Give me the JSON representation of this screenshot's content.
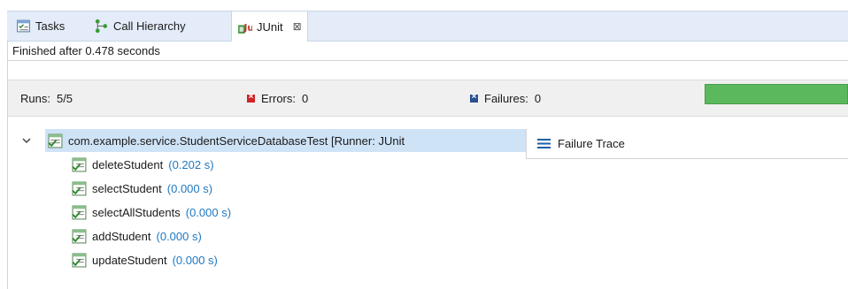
{
  "tabs": [
    {
      "label": "Tasks",
      "icon": "tasks-icon"
    },
    {
      "label": "Call Hierarchy",
      "icon": "call-hierarchy-icon"
    },
    {
      "label": "JUnit",
      "icon": "junit-icon",
      "active": true,
      "close_glyph": "⊠"
    }
  ],
  "status_text": "Finished after 0.478 seconds",
  "counters": {
    "runs_label": "Runs:",
    "runs_value": "5/5",
    "errors_label": "Errors:",
    "errors_value": "0",
    "failures_label": "Failures:",
    "failures_value": "0"
  },
  "progress": {
    "fraction": 1.0,
    "color": "#5cb85c"
  },
  "tree": {
    "root_label": "com.example.service.StudentServiceDatabaseTest [Runner: JUnit",
    "tests": [
      {
        "name": "deleteStudent",
        "time": "(0.202 s)"
      },
      {
        "name": "selectStudent",
        "time": "(0.000 s)"
      },
      {
        "name": "selectAllStudents",
        "time": "(0.000 s)"
      },
      {
        "name": "addStudent",
        "time": "(0.000 s)"
      },
      {
        "name": "updateStudent",
        "time": "(0.000 s)"
      }
    ]
  },
  "failure_trace": {
    "label": "Failure Trace",
    "icon": "stack-trace-icon"
  },
  "colors": {
    "accent_blue": "#1f78c1",
    "success_green": "#5cb85c",
    "error_red": "#d02424",
    "tab_bar": "#e3ecf8"
  }
}
